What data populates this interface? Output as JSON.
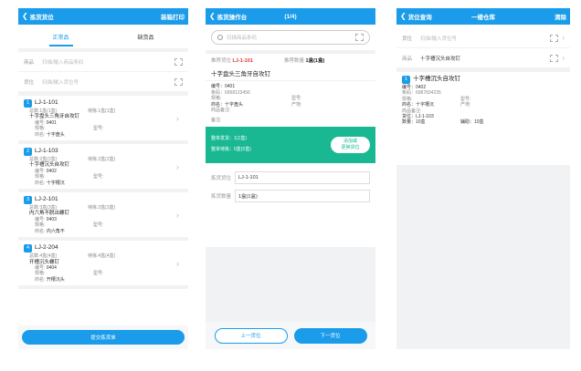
{
  "panel1": {
    "back_label": "拣货货位",
    "action_label": "装箱打印",
    "tabs": [
      "正常品",
      "缺货品"
    ],
    "product_field": {
      "label": "商品",
      "placeholder": "扫描/输入商品条码"
    },
    "location_field": {
      "label": "货位",
      "placeholder": "扫描/输入货位号"
    },
    "tasks": [
      {
        "index": "1",
        "location": "LJ-1-101",
        "total": "总数:1盒(1盒)",
        "pending": "待拣:1盒(1盒)",
        "name": "十字盘头三角牙自攻钉",
        "code_label": "编号:",
        "code": "0401",
        "spec_label": "规格:",
        "model_label": "型号:",
        "brand_label": "商名:",
        "brand": "十字盘头"
      },
      {
        "index": "2",
        "location": "LJ-1-103",
        "total": "总数:2盒(2盒)",
        "pending": "待拣:2盒(2盒)",
        "name": "十字槽沉头自攻钉",
        "code_label": "编号:",
        "code": "0402",
        "spec_label": "规格:",
        "model_label": "型号:",
        "brand_label": "商名:",
        "brand": "十字槽沉"
      },
      {
        "index": "3",
        "location": "LJ-2-101",
        "total": "总数:3盒(3盒)",
        "pending": "待拣:3盒(3盒)",
        "name": "内六角不脱出螺钉",
        "code_label": "编号:",
        "code": "0403",
        "spec_label": "规格:",
        "model_label": "型号:",
        "brand_label": "商名:",
        "brand": "内六角不"
      },
      {
        "index": "4",
        "location": "LJ-2-204",
        "total": "总数:4盒(4盒)",
        "pending": "待拣:4盒(4盒)",
        "name": "开槽沉头螺钉",
        "code_label": "编号:",
        "code": "0404",
        "spec_label": "规格:",
        "model_label": "型号:",
        "brand_label": "商名:",
        "brand": "开槽沉头"
      }
    ],
    "submit_label": "提交拣货单"
  },
  "panel2": {
    "back_label": "拣货操作台",
    "title": "(1/4)",
    "search_placeholder": "扫描商品条码",
    "rec_location_label": "推荐货位",
    "rec_location": "LJ-1-101",
    "rec_qty_label": "推荐数量",
    "rec_qty": "1盒(1盒)",
    "product_name": "十字盘头三角牙自攻钉",
    "info": {
      "code": "编号：0401",
      "barcode": "条码：6958123456",
      "spec": "规格:",
      "model": "型号:",
      "brand": "商名：十字盘头",
      "origin": "产地:",
      "product_note": "商品备注:",
      "note": "备注:"
    },
    "green": {
      "order_done": "整单发货：1(1盒)",
      "order_pending": "整单待拣：0盒(0盒)",
      "add_btn_line1": "添加或",
      "add_btn_line2": "更换货位"
    },
    "pick_location_label": "拣货货位",
    "pick_location_value": "LJ-1-101",
    "pick_qty_label": "拣货数量",
    "pick_qty_value": "1盒(1盒)",
    "prev_label": "上一货位",
    "next_label": "下一货位"
  },
  "panel3": {
    "back_label": "货位查询",
    "title": "一楼仓库",
    "right_label": "清除",
    "location_field": {
      "label": "货位",
      "placeholder": "扫描/输入货位号"
    },
    "product_field": {
      "label": "商品",
      "value": "十字槽沉头自攻钉"
    },
    "result": {
      "index": "1",
      "name": "十字槽沉头自攻钉",
      "code": "编号：0402",
      "barcode": "条码：6987834235",
      "spec": "规格:",
      "model": "型号:",
      "brand": "商名：十字槽沉",
      "origin": "产地:",
      "note": "商品备注:",
      "location": "货位：LJ-1-103",
      "qty": "数量：10盒",
      "aux": "辅助：10盒"
    }
  },
  "colors": {
    "primary": "#1a9cea",
    "green": "#19b893",
    "red": "#e0322e"
  }
}
